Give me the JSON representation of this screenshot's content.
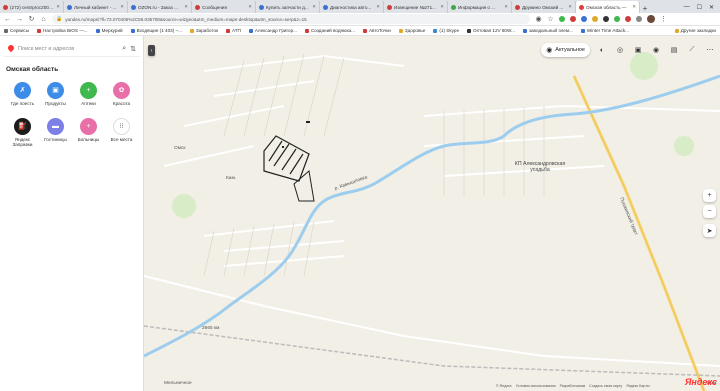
{
  "tabs": [
    {
      "title": "(272) centrproc2000 - ...",
      "color": "#d13b3b",
      "active": false
    },
    {
      "title": "Личный кабинет - ...",
      "color": "#3b6fd1",
      "active": false
    },
    {
      "title": "OZON.ru - Заказ ...",
      "color": "#3b6fd1",
      "active": false
    },
    {
      "title": "Сообщения",
      "color": "#d13b3b",
      "active": false
    },
    {
      "title": "Купить запчасти д...",
      "color": "#3b6fd1",
      "active": false
    },
    {
      "title": "Диагностика авто...",
      "color": "#3b6fd1",
      "active": false
    },
    {
      "title": "Извещение №271...",
      "color": "#d13b3b",
      "active": false
    },
    {
      "title": "Информация о ...",
      "color": "#3ba84a",
      "active": false
    },
    {
      "title": "Дружино Омский ...",
      "color": "#d13b3b",
      "active": false
    },
    {
      "title": "Омская область —",
      "color": "#e23b3b",
      "active": true
    }
  ],
  "address": {
    "url": "yandex.ru/maps/?ll=73.070406%2C55.035708&source=wizgeo&utm_medium=maps-desktop&utm_source=serp&z=15"
  },
  "bookmarks": [
    {
      "label": "Сервисы",
      "color": "#6a6a6a"
    },
    {
      "label": "Настройка BIOS —...",
      "color": "#d13b3b"
    },
    {
      "label": "Меркурий",
      "color": "#3b6fd1"
    },
    {
      "label": "Входящие (1 403) –...",
      "color": "#3b6fd1"
    },
    {
      "label": "Заработок",
      "color": "#e0a92b"
    },
    {
      "label": "АТП",
      "color": "#d13b3b"
    },
    {
      "label": "Александр Григор...",
      "color": "#3b6fd1"
    },
    {
      "label": "Созданий водяюка...",
      "color": "#d13b3b"
    },
    {
      "label": "АвтоТочки",
      "color": "#d13b3b"
    },
    {
      "label": "Здоровье",
      "color": "#e0a92b"
    },
    {
      "label": "(1) Skype",
      "color": "#3b8ad1"
    },
    {
      "label": "Оптовая 12V 80W...",
      "color": "#333333"
    },
    {
      "label": "заводальный элем...",
      "color": "#3b6fd1"
    },
    {
      "label": "Winter Time Attack...",
      "color": "#3b6fd1"
    }
  ],
  "bookmarks_right": [
    "Другие закладки"
  ],
  "panel": {
    "search_placeholder": "Поиск мест и адресов",
    "region_title": "Омская область",
    "categories_row1": [
      {
        "label": "Где поесть",
        "color": "#3c8ce8",
        "icon": "fork-knife-icon",
        "glyph": "✗"
      },
      {
        "label": "Продукты",
        "color": "#3c8ce8",
        "icon": "basket-icon",
        "glyph": "▣"
      },
      {
        "label": "Аптеки",
        "color": "#3fb84c",
        "icon": "pharmacy-icon",
        "glyph": "+"
      },
      {
        "label": "Красота",
        "color": "#e86fa8",
        "icon": "beauty-icon",
        "glyph": "✿"
      }
    ],
    "categories_row2": [
      {
        "label": "Яндекс Заправки",
        "color": "#1c1c1c",
        "icon": "fuel-icon",
        "glyph": "⛽"
      },
      {
        "label": "Гостиницы",
        "color": "#7b7fe6",
        "icon": "bed-icon",
        "glyph": "▬"
      },
      {
        "label": "Больницы",
        "color": "#e86fa8",
        "icon": "hospital-icon",
        "glyph": "+"
      },
      {
        "label": "Все места",
        "color": "#ffffff",
        "icon": "grid-icon",
        "glyph": "⁝⁝"
      }
    ]
  },
  "map": {
    "actual_label": "Актуальное",
    "place_labels": {
      "settlement": "КП Александровская усадьба",
      "road_name": "Пушкинский тракт",
      "river": "р. Камышловка",
      "distance_post": "2665 км",
      "village": "Мельничное",
      "street1": "Кам.",
      "street2": "Омск"
    },
    "copyright_items": [
      "© Яндекс",
      "Условия использования",
      "Разработчикам",
      "Создать свою карту",
      "Яндекс Карты"
    ],
    "logo_text": "Яндекс",
    "scale_text": "100 м",
    "colors": {
      "river": "#9ccdee",
      "background": "#f2efe6",
      "road": "#f7d26b",
      "greenery": "#d8ecc7"
    }
  }
}
